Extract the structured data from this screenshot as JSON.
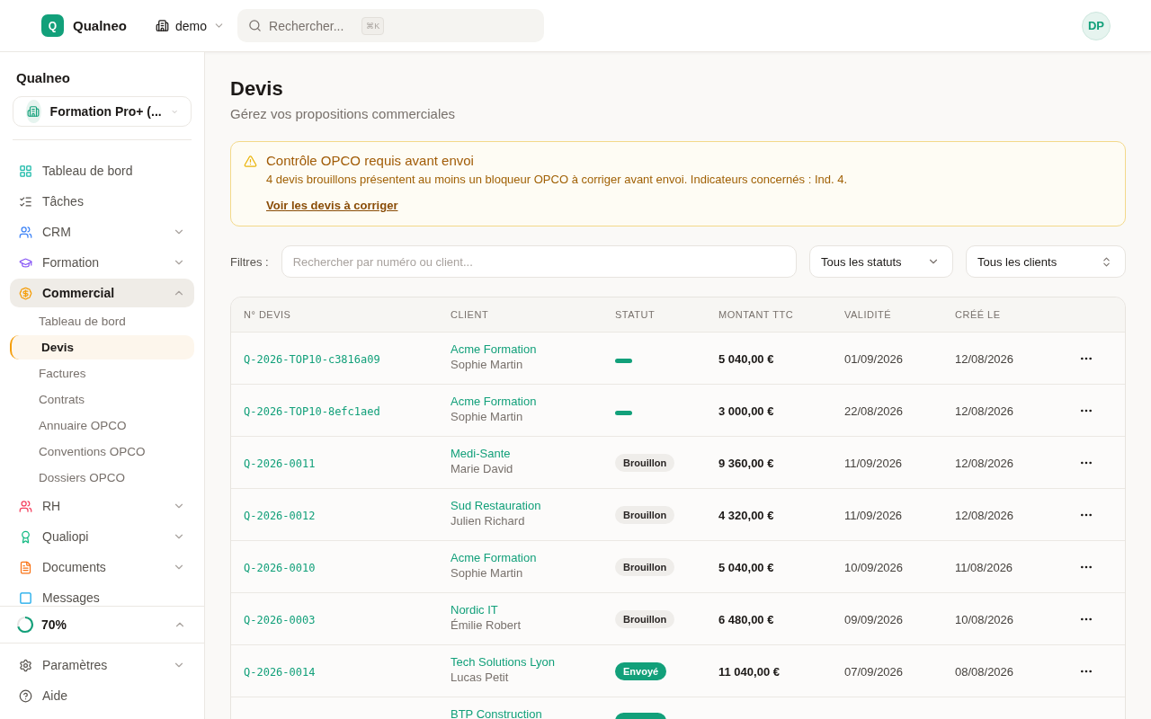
{
  "header": {
    "brand_initial": "Q",
    "brand": "Qualneo",
    "workspace": "demo",
    "search_placeholder": "Rechercher...",
    "shortcut": "⌘K",
    "avatar": "DP"
  },
  "sidebar": {
    "title": "Qualneo",
    "organization": "Formation Pro+ (...",
    "items": [
      {
        "label": "Tableau de bord",
        "selected": false
      },
      {
        "label": "Tâches",
        "selected": false
      },
      {
        "label": "CRM",
        "selected": false,
        "expanded": false
      },
      {
        "label": "Formation",
        "selected": false,
        "expanded": false
      },
      {
        "label": "Commercial",
        "selected": true,
        "expanded": true,
        "children": [
          {
            "label": "Tableau de bord",
            "selected": false
          },
          {
            "label": "Devis",
            "selected": true
          },
          {
            "label": "Factures",
            "selected": false
          },
          {
            "label": "Contrats",
            "selected": false
          },
          {
            "label": "Annuaire OPCO",
            "selected": false
          },
          {
            "label": "Conventions OPCO",
            "selected": false
          },
          {
            "label": "Dossiers OPCO",
            "selected": false
          }
        ]
      },
      {
        "label": "RH",
        "selected": false,
        "expanded": false
      },
      {
        "label": "Qualiopi",
        "selected": false,
        "expanded": false
      },
      {
        "label": "Documents",
        "selected": false,
        "expanded": false
      },
      {
        "label": "Messages",
        "selected": false
      }
    ],
    "progress": {
      "label": "70%",
      "level": 0.7,
      "expanded": false
    },
    "footer": [
      {
        "label": "Paramètres",
        "expanded": false
      },
      {
        "label": "Aide"
      }
    ]
  },
  "page": {
    "title": "Devis",
    "subtitle": "Gérez vos propositions commerciales"
  },
  "alert": {
    "title": "Contrôle OPCO requis avant envoi",
    "message": "4 devis brouillons présentent au moins un bloqueur OPCO à corriger avant envoi. Indicateurs concernés : Ind. 4.",
    "link": "Voir les devis à corriger"
  },
  "filters": {
    "label": "Filtres :",
    "search_placeholder": "Rechercher par numéro ou client...",
    "status": "Tous les statuts",
    "client": "Tous les clients"
  },
  "table": {
    "columns": [
      "N° DEVIS",
      "CLIENT",
      "STATUT",
      "MONTANT TTC",
      "VALIDITÉ",
      "CRÉÉ LE"
    ],
    "rows": [
      {
        "number": "Q-2026-TOP10-c3816a09",
        "client": "Acme Formation",
        "contact": "Sophie Martin",
        "status": {
          "kind": "bar"
        },
        "amount": "5 040,00 €",
        "validity": "01/09/2026",
        "created": "12/08/2026"
      },
      {
        "number": "Q-2026-TOP10-8efc1aed",
        "client": "Acme Formation",
        "contact": "Sophie Martin",
        "status": {
          "kind": "bar"
        },
        "amount": "3 000,00 €",
        "validity": "22/08/2026",
        "created": "12/08/2026"
      },
      {
        "number": "Q-2026-0011",
        "client": "Medi-Sante",
        "contact": "Marie David",
        "status": {
          "kind": "draft",
          "label": "Brouillon"
        },
        "amount": "9 360,00 €",
        "validity": "11/09/2026",
        "created": "12/08/2026"
      },
      {
        "number": "Q-2026-0012",
        "client": "Sud Restauration",
        "contact": "Julien Richard",
        "status": {
          "kind": "draft",
          "label": "Brouillon"
        },
        "amount": "4 320,00 €",
        "validity": "11/09/2026",
        "created": "12/08/2026"
      },
      {
        "number": "Q-2026-0010",
        "client": "Acme Formation",
        "contact": "Sophie Martin",
        "status": {
          "kind": "draft",
          "label": "Brouillon"
        },
        "amount": "5 040,00 €",
        "validity": "10/09/2026",
        "created": "11/08/2026"
      },
      {
        "number": "Q-2026-0003",
        "client": "Nordic IT",
        "contact": "Émilie Robert",
        "status": {
          "kind": "draft",
          "label": "Brouillon"
        },
        "amount": "6 480,00 €",
        "validity": "09/09/2026",
        "created": "10/08/2026"
      },
      {
        "number": "Q-2026-0014",
        "client": "Tech Solutions Lyon",
        "contact": "Lucas Petit",
        "status": {
          "kind": "sent",
          "label": "Envoyé"
        },
        "amount": "11 040,00 €",
        "validity": "07/09/2026",
        "created": "08/08/2026"
      },
      {
        "client": "BTP Construction",
        "status": {
          "kind": "sent"
        }
      }
    ]
  }
}
